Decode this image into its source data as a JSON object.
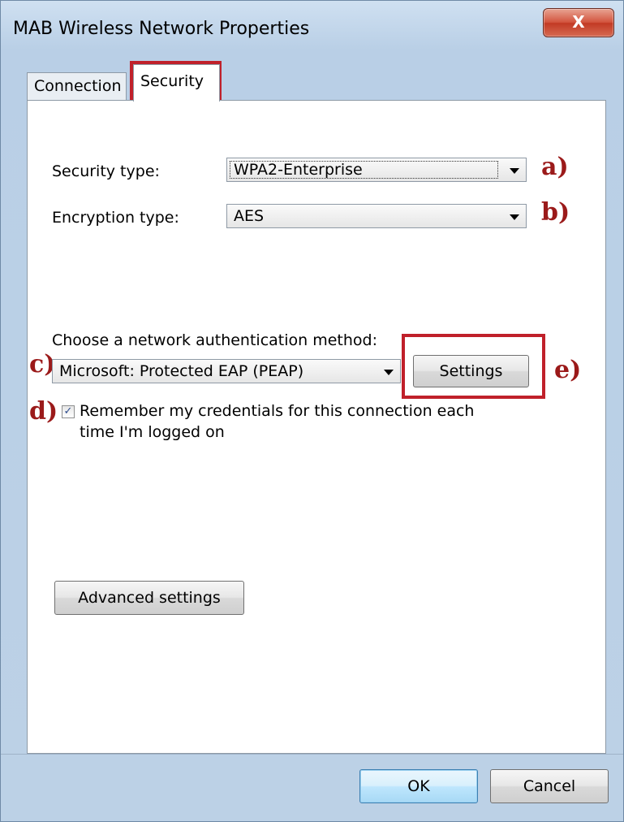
{
  "window": {
    "title": "MAB Wireless Network Properties",
    "close_glyph": "X"
  },
  "tabs": [
    {
      "label": "Connection",
      "active": false
    },
    {
      "label": "Security",
      "active": true
    }
  ],
  "security": {
    "security_type_label": "Security type:",
    "security_type_value": "WPA2-Enterprise",
    "encryption_type_label": "Encryption type:",
    "encryption_type_value": "AES",
    "auth_method_label": "Choose a network authentication method:",
    "auth_method_value": "Microsoft: Protected EAP (PEAP)",
    "settings_label": "Settings",
    "remember_line1": "Remember my credentials for this connection each",
    "remember_line2": "time I'm logged on",
    "remember_checked": true,
    "advanced_label": "Advanced settings"
  },
  "footer": {
    "ok_label": "OK",
    "cancel_label": "Cancel"
  },
  "annotations": {
    "a": "a)",
    "b": "b)",
    "c": "c)",
    "d": "d)",
    "e": "e)"
  },
  "colors": {
    "annotation": "#9b1a1a",
    "highlight_box": "#c0202a"
  }
}
